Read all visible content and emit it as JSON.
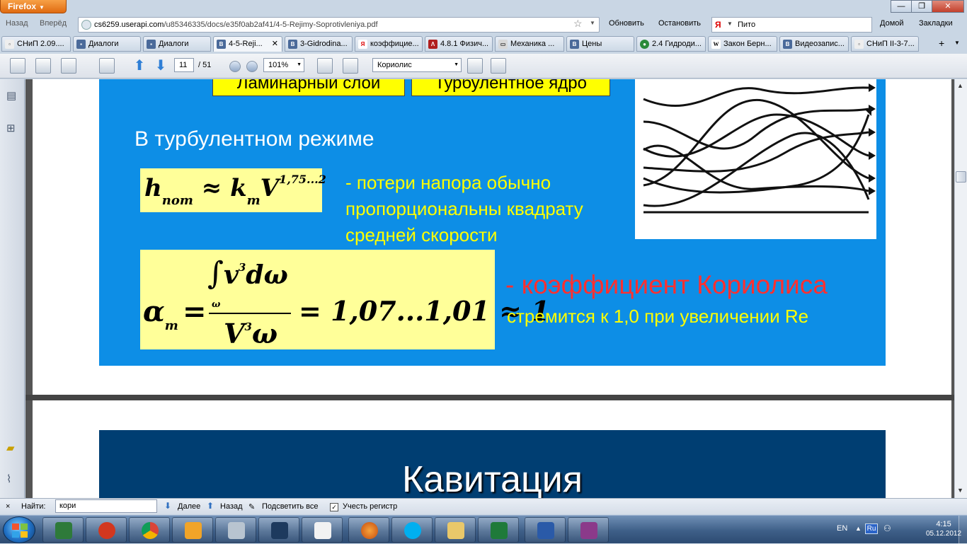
{
  "browser": {
    "menu_button": "Firefox",
    "nav": {
      "back": "Назад",
      "forward": "Вперёд",
      "refresh": "Обновить",
      "stop": "Остановить",
      "home": "Домой",
      "bookmarks": "Закладки"
    },
    "url": {
      "host": "cs6259.userapi.com",
      "path": "/u85346335/docs/e35f0ab2af41/4-5-Rejimy-Soprotivleniya.pdf"
    },
    "search": {
      "value": "Пито"
    },
    "tabs": [
      {
        "label": "СНиП 2.09....",
        "icon": "page-icon"
      },
      {
        "label": "Диалоги",
        "icon": "chat-icon"
      },
      {
        "label": "Диалоги",
        "icon": "chat-icon"
      },
      {
        "label": "4-5-Reji...",
        "icon": "vk-icon",
        "active": true
      },
      {
        "label": "3-Gidrodina...",
        "icon": "vk-icon"
      },
      {
        "label": "коэффицие...",
        "icon": "yandex-icon"
      },
      {
        "label": "4.8.1 Физич...",
        "icon": "pdf-icon"
      },
      {
        "label": "Механика ...",
        "icon": "folder-icon"
      },
      {
        "label": "Цены",
        "icon": "vk-icon"
      },
      {
        "label": "2.4 Гидроди...",
        "icon": "globe-icon"
      },
      {
        "label": "Закон Берн...",
        "icon": "wikipedia-icon"
      },
      {
        "label": "Видеозапис...",
        "icon": "vk-icon"
      },
      {
        "label": "СНиП II-3-7...",
        "icon": "page-icon"
      }
    ]
  },
  "pdf_toolbar": {
    "page_current": "11",
    "page_total": "/ 51",
    "zoom": "101%",
    "find": "Кориолис"
  },
  "slide1": {
    "label_laminar": "Ламинарный слой",
    "label_turbulent": "Турбулентное ядро",
    "turbulent_title": "В турбулентном режиме",
    "formula1": {
      "h": "h",
      "h_sub": "пот",
      "approx": "≈",
      "k": "k",
      "k_sub": "m",
      "V": "V",
      "exp": "1,75...2"
    },
    "desc1": [
      "- потери напора обычно",
      "пропорциональны квадрату",
      "средней скорости"
    ],
    "formula2": {
      "alpha": "α",
      "alpha_sub": "m",
      "eq": "=",
      "integral": "∫",
      "v": "v",
      "v_exp": "3",
      "domega": "dω",
      "int_sub": "ω",
      "V": "V",
      "V_exp": "3",
      "omega": "ω",
      "right": "= 1,07...1,01 ≈ 1"
    },
    "coriolis_red": "- коэффициент Кориолиса",
    "coriolis_yellow": "стремится к 1,0 при увеличении Re"
  },
  "slide2": {
    "title": "Кавитация"
  },
  "findbar": {
    "close": "×",
    "label": "Найти:",
    "value": "кори",
    "next": "Далее",
    "prev": "Назад",
    "highlight": "Подсветить все",
    "match_case": "Учесть регистр"
  },
  "taskbar": {
    "apps": [
      "explorer-icon",
      "ccleaner-icon",
      "chrome-icon",
      "media-player-icon",
      "calculator-icon",
      "kmplayer-icon",
      "calendar-icon",
      "firefox-icon",
      "skype-icon",
      "folder-icon",
      "excel-icon",
      "word-icon",
      "winrar-icon"
    ],
    "lang": "EN",
    "lang_box": "Ru",
    "time": "4:15",
    "date": "05.12.2012"
  },
  "colors": {
    "slide1_bg": "#0d8ee6",
    "slide2_bg": "#003e72",
    "formula_bg": "#ffff99",
    "label_bg": "#ffff00",
    "red_text": "#ff3030",
    "yellow_text": "#ffff00"
  }
}
